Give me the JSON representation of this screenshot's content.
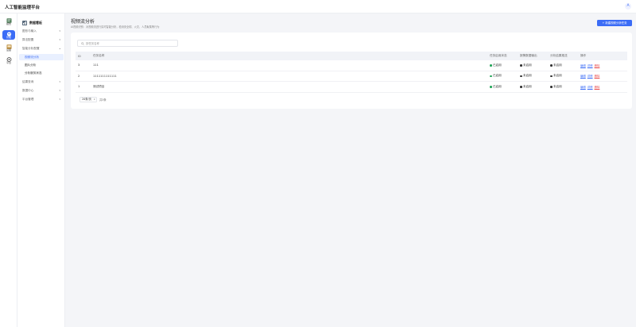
{
  "app": {
    "title": "人工智能监理平台",
    "avatar": "A"
  },
  "rail": [
    {
      "label": "报告",
      "icon": "report-icon",
      "active": false
    },
    {
      "label": "智能",
      "icon": "ai-brain-icon",
      "active": true
    },
    {
      "label": "设备",
      "icon": "device-icon",
      "active": false
    },
    {
      "label": "平台",
      "icon": "platform-settings-icon",
      "active": false
    }
  ],
  "sidebar": {
    "header": "数据看板",
    "items": [
      {
        "label": "图形与输入",
        "chevron": "▾",
        "type": "group"
      },
      {
        "label": "算法配置",
        "chevron": "▾",
        "type": "group"
      },
      {
        "label": "智能分析配置",
        "chevron": "▴",
        "type": "group"
      },
      {
        "label": "视频流分析",
        "chevron": "",
        "type": "sub",
        "active": true
      },
      {
        "label": "图片分析",
        "chevron": "",
        "type": "sub"
      },
      {
        "label": "分析服务状态",
        "chevron": "",
        "type": "sub"
      },
      {
        "label": "结果查询",
        "chevron": "▾",
        "type": "group"
      },
      {
        "label": "数据中心",
        "chevron": "▾",
        "type": "group"
      },
      {
        "label": "平台管理",
        "chevron": "▾",
        "type": "group"
      }
    ]
  },
  "page": {
    "title": "视频流分析",
    "subtitle": "AI视频识别：对视频流进行实时智能分析，检测安全帽、火灾、人员聚集等行为",
    "create_button": "+ 新建视频分析任务"
  },
  "search": {
    "placeholder": "按任务名称"
  },
  "table": {
    "columns": [
      "ID",
      "任务名称",
      "任务启用状态",
      "报警数据输出",
      "分析结果推送",
      "操作"
    ],
    "rows": [
      {
        "id": "3",
        "name": "111",
        "s1": "已启用",
        "s2": "未启用",
        "s3": "未启用"
      },
      {
        "id": "2",
        "name": "1111111111111",
        "s1": "已启用",
        "s2": "未启用",
        "s3": "未启用"
      },
      {
        "id": "1",
        "name": "测试项目",
        "s1": "已启用",
        "s2": "未启用",
        "s3": "未启用"
      }
    ],
    "actions": [
      "编辑",
      "详情",
      "删除"
    ]
  },
  "pagination": {
    "page_size": "20条/页",
    "total": "共3条"
  },
  "colors": {
    "primary": "#3b6cf6",
    "enabled": "#23a559",
    "disabled": "#333333",
    "danger": "#e84c4c"
  }
}
